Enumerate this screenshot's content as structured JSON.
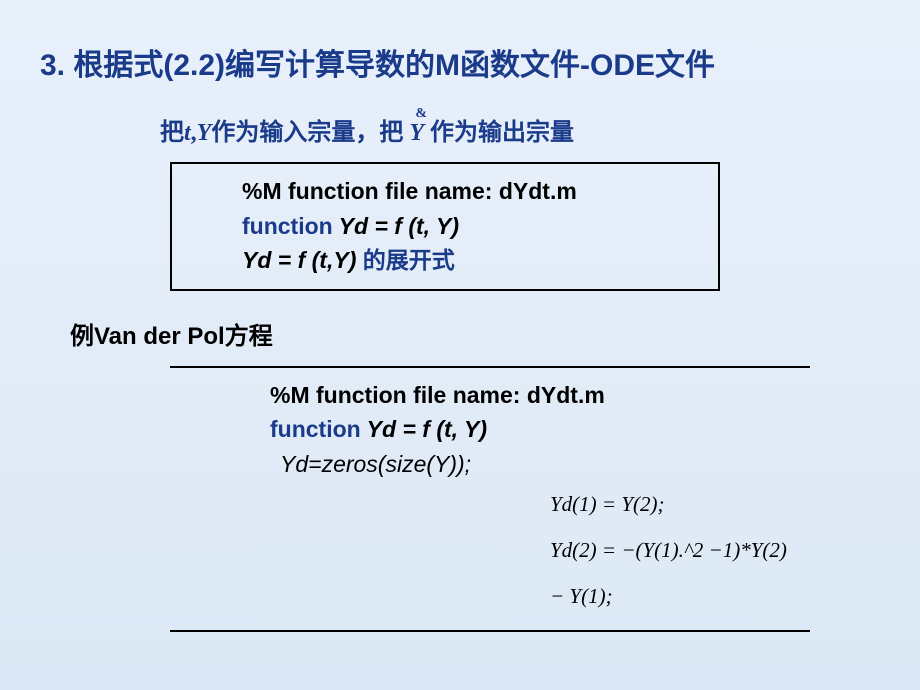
{
  "heading": "3. 根据式(2.2)编写计算导数的M函数文件-ODE文件",
  "subheading_part1": "把",
  "subheading_var_t": "t",
  "subheading_comma": ",",
  "subheading_var_Y": "Y",
  "subheading_part2": "作为输入宗量，把 ",
  "subheading_ydot": "Y",
  "subheading_part3": "作为输出宗量",
  "box1": {
    "comment": "%M function file name: dYdt.m",
    "function_kw": "function",
    "function_sig": "   Yd = f (t, Y)",
    "expand_lhs": "Yd = f (t,Y) ",
    "expand_rhs": "的展开式"
  },
  "example_label": "例Van der Pol方程",
  "box2": {
    "comment": "%M function file name: dYdt.m",
    "function_kw": "function",
    "function_sig": "   Yd = f (t, Y)",
    "zeros": "Yd=zeros(size(Y));"
  },
  "math": {
    "eq1": "Yd(1) = Y(2);",
    "eq2": "Yd(2) = −(Y(1).^2 −1)*Y(2) − Y(1);"
  }
}
